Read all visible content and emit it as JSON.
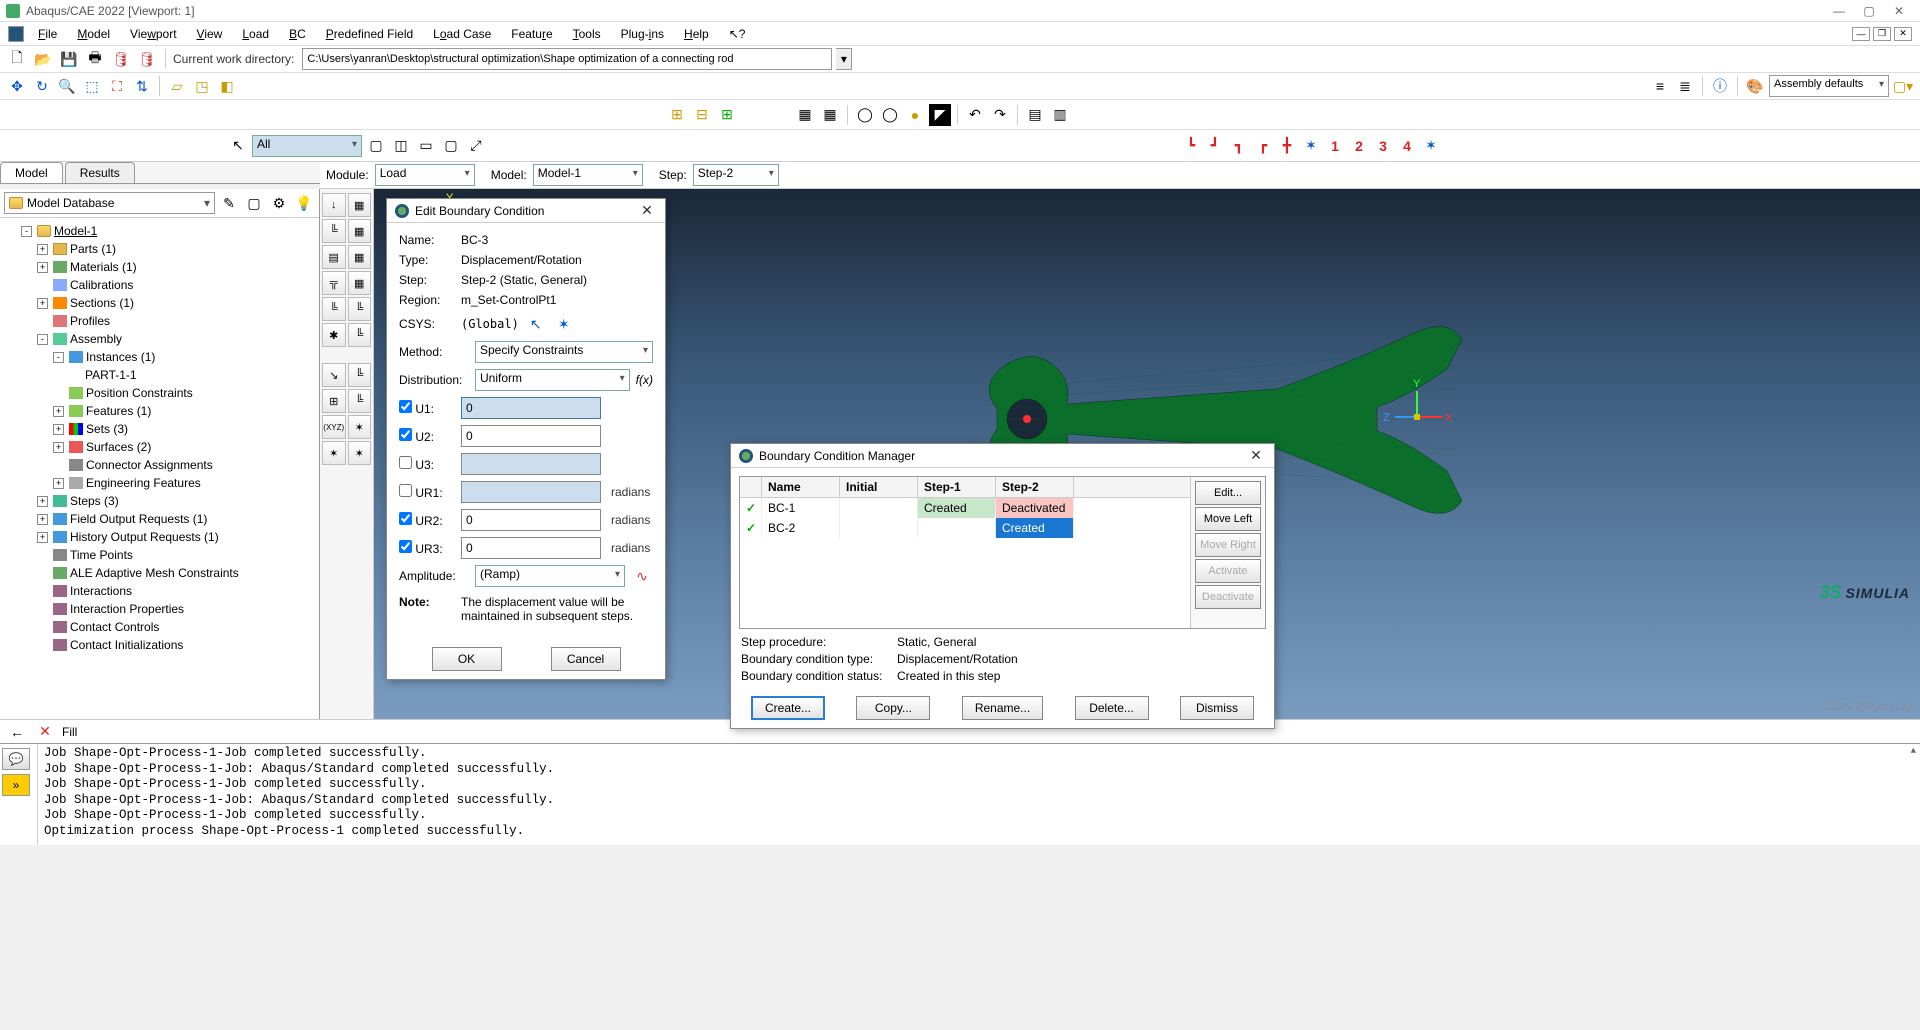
{
  "title": "Abaqus/CAE 2022 [Viewport: 1]",
  "menu": [
    "File",
    "Model",
    "Viewport",
    "View",
    "Load",
    "BC",
    "Predefined Field",
    "Load Case",
    "Feature",
    "Tools",
    "Plug-ins",
    "Help"
  ],
  "workdir_label": "Current work directory:",
  "workdir": "C:\\Users\\yanran\\Desktop\\structural optimization\\Shape optimization of a connecting rod",
  "combo_assembly": "Assembly defaults",
  "filter_all": "All",
  "ctx": {
    "module_label": "Module:",
    "module": "Load",
    "model_label": "Model:",
    "model": "Model-1",
    "step_label": "Step:",
    "step": "Step-2"
  },
  "tabs": {
    "model": "Model",
    "results": "Results"
  },
  "treehdr": "Model Database",
  "tree": [
    {
      "ind": 1,
      "exp": "-",
      "icon": "ic-db",
      "label": "Model-1",
      "u": true
    },
    {
      "ind": 2,
      "exp": "+",
      "icon": "ic-folder",
      "label": "Parts (1)"
    },
    {
      "ind": 2,
      "exp": "+",
      "icon": "ic-mat",
      "label": "Materials (1)"
    },
    {
      "ind": 2,
      "exp": "",
      "icon": "ic-cal",
      "label": "Calibrations"
    },
    {
      "ind": 2,
      "exp": "+",
      "icon": "ic-sect",
      "label": "Sections (1)"
    },
    {
      "ind": 2,
      "exp": "",
      "icon": "ic-prof",
      "label": "Profiles"
    },
    {
      "ind": 2,
      "exp": "-",
      "icon": "ic-asm",
      "label": "Assembly"
    },
    {
      "ind": 3,
      "exp": "-",
      "icon": "ic-inst",
      "label": "Instances (1)"
    },
    {
      "ind": 4,
      "exp": "",
      "icon": "",
      "label": "PART-1-1"
    },
    {
      "ind": 3,
      "exp": "",
      "icon": "ic-feat",
      "label": "Position Constraints"
    },
    {
      "ind": 3,
      "exp": "+",
      "icon": "ic-feat",
      "label": "Features (1)"
    },
    {
      "ind": 3,
      "exp": "+",
      "icon": "ic-xyz",
      "label": "Sets (3)"
    },
    {
      "ind": 3,
      "exp": "+",
      "icon": "ic-surf",
      "label": "Surfaces (2)"
    },
    {
      "ind": 3,
      "exp": "",
      "icon": "ic-conn",
      "label": "Connector Assignments"
    },
    {
      "ind": 3,
      "exp": "+",
      "icon": "ic-eng",
      "label": "Engineering Features"
    },
    {
      "ind": 2,
      "exp": "+",
      "icon": "ic-step",
      "label": "Steps (3)"
    },
    {
      "ind": 2,
      "exp": "+",
      "icon": "ic-fout",
      "label": "Field Output Requests (1)"
    },
    {
      "ind": 2,
      "exp": "+",
      "icon": "ic-hout",
      "label": "History Output Requests (1)"
    },
    {
      "ind": 2,
      "exp": "",
      "icon": "ic-time",
      "label": "Time Points"
    },
    {
      "ind": 2,
      "exp": "",
      "icon": "ic-mesh",
      "label": "ALE Adaptive Mesh Constraints"
    },
    {
      "ind": 2,
      "exp": "",
      "icon": "ic-int",
      "label": "Interactions"
    },
    {
      "ind": 2,
      "exp": "",
      "icon": "ic-int",
      "label": "Interaction Properties"
    },
    {
      "ind": 2,
      "exp": "",
      "icon": "ic-int",
      "label": "Contact Controls"
    },
    {
      "ind": 2,
      "exp": "",
      "icon": "ic-int",
      "label": "Contact Initializations"
    }
  ],
  "editbc": {
    "title": "Edit Boundary Condition",
    "name_l": "Name:",
    "name": "BC-3",
    "type_l": "Type:",
    "type": "Displacement/Rotation",
    "step_l": "Step:",
    "step": "Step-2 (Static, General)",
    "region_l": "Region:",
    "region": "m_Set-ControlPt1",
    "csys_l": "CSYS:",
    "csys": "(Global)",
    "method_l": "Method:",
    "method": "Specify Constraints",
    "dist_l": "Distribution:",
    "dist": "Uniform",
    "fx": "f(x)",
    "u1_l": "U1:",
    "u1": "0",
    "u2_l": "U2:",
    "u2": "0",
    "u3_l": "U3:",
    "u3": "",
    "ur1_l": "UR1:",
    "ur1": "",
    "ur2_l": "UR2:",
    "ur2": "0",
    "ur3_l": "UR3:",
    "ur3": "0",
    "rad": "radians",
    "amp_l": "Amplitude:",
    "amp": "(Ramp)",
    "note_l": "Note:",
    "note": "The displacement value will be maintained in subsequent steps.",
    "ok": "OK",
    "cancel": "Cancel"
  },
  "bcmgr": {
    "title": "Boundary Condition Manager",
    "cols": [
      "",
      "Name",
      "Initial",
      "Step-1",
      "Step-2"
    ],
    "rows": [
      {
        "chk": "✓",
        "name": "BC-1",
        "initial": "",
        "s1": "Created",
        "s1c": "bc-green",
        "s2": "Deactivated",
        "s2c": "bc-red"
      },
      {
        "chk": "✓",
        "name": "BC-2",
        "initial": "",
        "s1": "",
        "s1c": "",
        "s2": "Created",
        "s2c": "bc-blue"
      }
    ],
    "side": [
      "Edit...",
      "Move Left",
      "Move Right",
      "Activate",
      "Deactivate"
    ],
    "side_disabled": [
      false,
      false,
      true,
      true,
      true
    ],
    "info": [
      [
        "Step procedure:",
        "Static, General"
      ],
      [
        "Boundary condition type:",
        "Displacement/Rotation"
      ],
      [
        "Boundary condition status:",
        "Created in this step"
      ]
    ],
    "btns": [
      "Create...",
      "Copy...",
      "Rename...",
      "Delete...",
      "Dismiss"
    ]
  },
  "msgs": [
    "Job Shape-Opt-Process-1-Job completed successfully.",
    "Job Shape-Opt-Process-1-Job: Abaqus/Standard completed successfully.",
    "Job Shape-Opt-Process-1-Job completed successfully.",
    "Job Shape-Opt-Process-1-Job: Abaqus/Standard completed successfully.",
    "Job Shape-Opt-Process-1-Job completed successfully.",
    "Optimization process Shape-Opt-Process-1 completed successfully."
  ],
  "brand": "SIMULIA",
  "fill_label": "Fill",
  "footer_wm": "CSDN @Ryan-Lily"
}
